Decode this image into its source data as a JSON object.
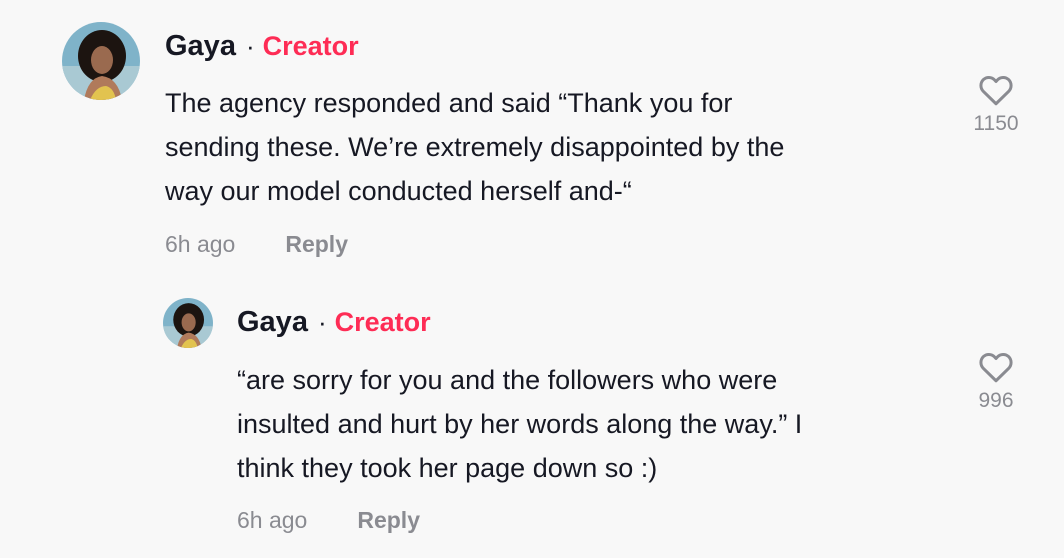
{
  "comments": [
    {
      "author": "Gaya",
      "separator": "·",
      "badge": "Creator",
      "text_lines": [
        "The agency responded and said “Thank you for",
        "sending these. We’re extremely disappointed by the",
        "way our model conducted herself and-“"
      ],
      "time": "6h ago",
      "reply_label": "Reply",
      "likes": "1150",
      "like_icon": "heart-outline-icon"
    },
    {
      "author": "Gaya",
      "separator": "·",
      "badge": "Creator",
      "text_lines": [
        "“are sorry for you and the followers who were",
        "insulted and hurt by her words along the way.” I",
        "think they took her page down so :)"
      ],
      "time": "6h ago",
      "reply_label": "Reply",
      "likes": "996",
      "like_icon": "heart-outline-icon"
    }
  ],
  "colors": {
    "background": "#f8f8f8",
    "text": "#161823",
    "badge": "#fe2c55",
    "secondary": "#8a8b91"
  }
}
